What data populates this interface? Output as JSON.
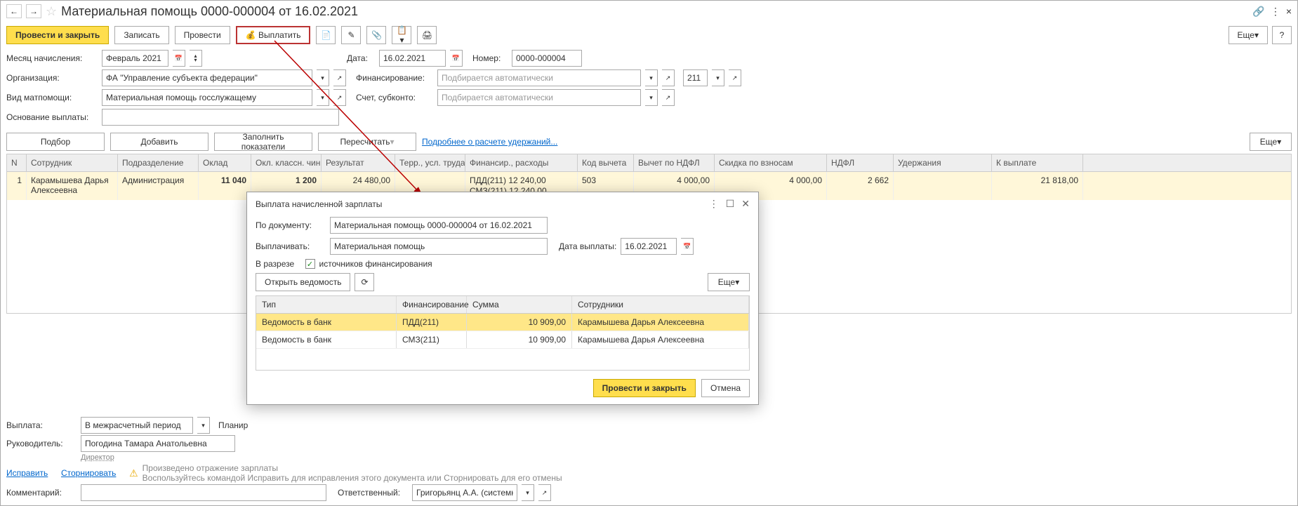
{
  "title": "Материальная помощь 0000-000004 от 16.02.2021",
  "toolbar": {
    "post_close": "Провести и закрыть",
    "write": "Записать",
    "post": "Провести",
    "pay": "Выплатить",
    "more": "Еще",
    "help": "?"
  },
  "fields": {
    "month_label": "Месяц начисления:",
    "month_value": "Февраль 2021",
    "date_label": "Дата:",
    "date_value": "16.02.2021",
    "number_label": "Номер:",
    "number_value": "0000-000004",
    "org_label": "Организация:",
    "org_value": "ФА \"Управление субъекта федерации\"",
    "fin_label": "Финансирование:",
    "fin_placeholder": "Подбирается автоматически",
    "kosgu_value": "211",
    "type_label": "Вид матпомощи:",
    "type_value": "Материальная помощь госслужащему",
    "account_label": "Счет, субконто:",
    "account_placeholder": "Подбирается автоматически",
    "reason_label": "Основание выплаты:"
  },
  "table_toolbar": {
    "pick": "Подбор",
    "add": "Добавить",
    "fill": "Заполнить показатели",
    "recalc": "Пересчитать",
    "details_link": "Подробнее о расчете удержаний...",
    "more": "Еще"
  },
  "columns": {
    "n": "N",
    "emp": "Сотрудник",
    "dept": "Подразделение",
    "salary": "Оклад",
    "classrank": "Окл. классн. чин",
    "result": "Результат",
    "terr": "Терр., усл. труда",
    "finexp": "Финансир., расходы",
    "dedcode": "Код вычета",
    "ndfl_ded": "Вычет по НДФЛ",
    "contr_disc": "Скидка по взносам",
    "ndfl": "НДФЛ",
    "withh": "Удержания",
    "topay": "К выплате"
  },
  "rows": [
    {
      "n": "1",
      "emp": "Карамышева Дарья Алексеевна",
      "dept": "Администрация",
      "salary": "11 040",
      "classrank": "1 200",
      "result": "24 480,00",
      "finexp1": "ПДД(211) 12 240,00",
      "finexp2": "СМЗ(211) 12 240,00",
      "dedcode": "503",
      "ndfl_ded": "4 000,00",
      "contr_disc": "4 000,00",
      "ndfl": "2 662",
      "topay": "21 818,00"
    }
  ],
  "footer": {
    "pay_label": "Выплата:",
    "pay_value": "В межрасчетный период",
    "plan_label": "Планир",
    "mgr_label": "Руководитель:",
    "mgr_value": "Погодина Тамара Анатольевна",
    "mgr_role": "Директор",
    "fix": "Исправить",
    "storno": "Сторнировать",
    "warn1": "Произведено отражение зарплаты",
    "warn2": "Воспользуйтесь командой Исправить для исправления этого документа или Сторнировать для его отмены",
    "comment_label": "Комментарий:",
    "resp_label": "Ответственный:",
    "resp_value": "Григорьянц А.А. (системн"
  },
  "dialog": {
    "title": "Выплата начисленной зарплаты",
    "doc_label": "По документу:",
    "doc_value": "Материальная помощь 0000-000004 от 16.02.2021",
    "what_label": "Выплачивать:",
    "what_value": "Материальная помощь",
    "paydate_label": "Дата выплаты:",
    "paydate_value": "16.02.2021",
    "split_label": "В разрезе",
    "split_check": "источников финансирования",
    "open_btn": "Открыть ведомость",
    "more": "Еще",
    "cols": {
      "type": "Тип",
      "fin": "Финансирование",
      "sum": "Сумма",
      "emp": "Сотрудники"
    },
    "rows": [
      {
        "type": "Ведомость в банк",
        "fin": "ПДД(211)",
        "sum": "10 909,00",
        "emp": "Карамышева Дарья Алексеевна"
      },
      {
        "type": "Ведомость в банк",
        "fin": "СМЗ(211)",
        "sum": "10 909,00",
        "emp": "Карамышева Дарья Алексеевна"
      }
    ],
    "post_close": "Провести и закрыть",
    "cancel": "Отмена"
  }
}
